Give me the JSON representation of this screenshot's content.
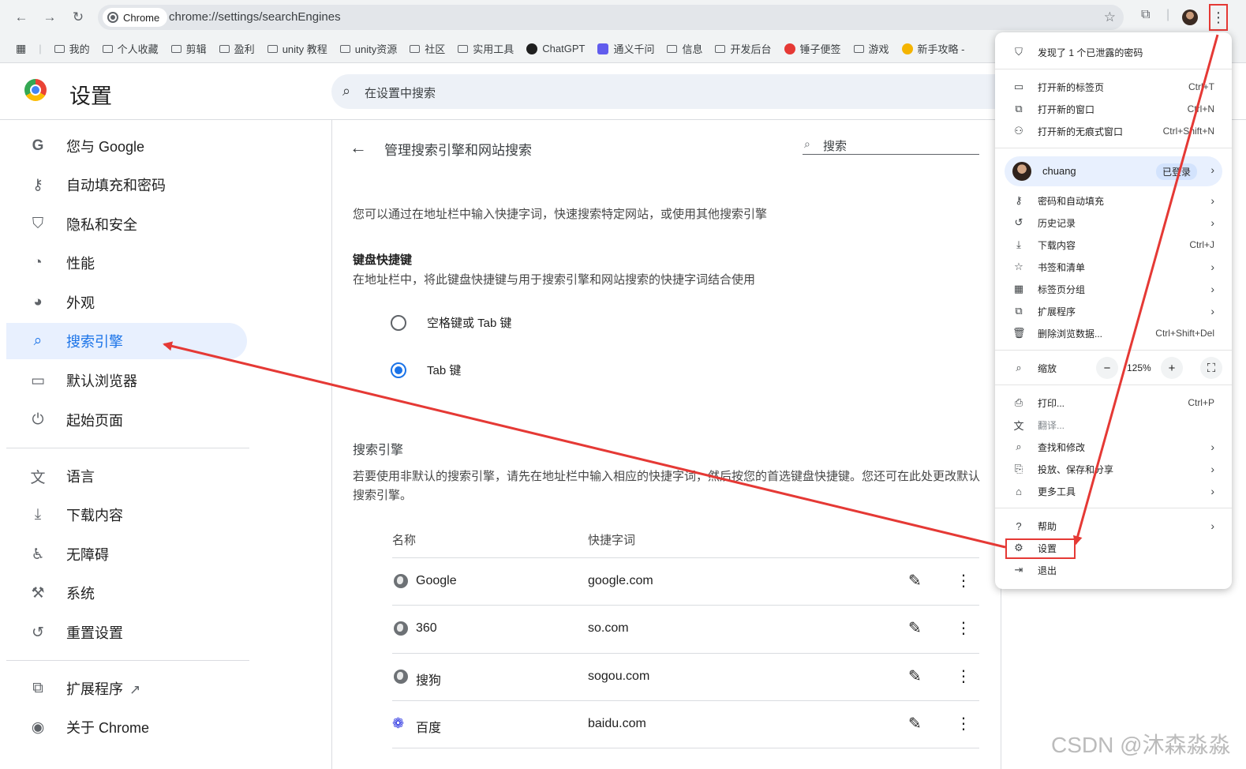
{
  "browser": {
    "chip_label": "Chrome",
    "url": "chrome://settings/searchEngines",
    "bookmarks": [
      "我的",
      "个人收藏",
      "剪辑",
      "盈利",
      "unity 教程",
      "unity资源",
      "社区",
      "实用工具",
      "ChatGPT",
      "通义千问",
      "信息",
      "开发后台",
      "锤子便签",
      "游戏",
      "新手攻略 -"
    ]
  },
  "header": {
    "title": "设置",
    "search_placeholder": "在设置中搜索"
  },
  "sidebar": {
    "items": [
      {
        "label": "您与 Google",
        "icon": "google-g-icon"
      },
      {
        "label": "自动填充和密码",
        "icon": "key-icon"
      },
      {
        "label": "隐私和安全",
        "icon": "shield-icon"
      },
      {
        "label": "性能",
        "icon": "speedometer-icon"
      },
      {
        "label": "外观",
        "icon": "palette-icon"
      },
      {
        "label": "搜索引擎",
        "icon": "search-icon"
      },
      {
        "label": "默认浏览器",
        "icon": "browser-window-icon"
      },
      {
        "label": "起始页面",
        "icon": "power-icon"
      },
      {
        "label": "语言",
        "icon": "translate-icon"
      },
      {
        "label": "下载内容",
        "icon": "download-icon"
      },
      {
        "label": "无障碍",
        "icon": "accessibility-icon"
      },
      {
        "label": "系统",
        "icon": "wrench-icon"
      },
      {
        "label": "重置设置",
        "icon": "reset-icon"
      },
      {
        "label": "扩展程序",
        "icon": "puzzle-icon"
      },
      {
        "label": "关于 Chrome",
        "icon": "chrome-icon"
      }
    ],
    "active_index": 5
  },
  "main": {
    "page_title": "管理搜索引擎和网站搜索",
    "search_placeholder": "搜索",
    "intro": "您可以通过在地址栏中输入快捷字词，快速搜索特定网站，或使用其他搜索引擎",
    "shortcut_heading": "键盘快捷键",
    "shortcut_desc": "在地址栏中，将此键盘快捷键与用于搜索引擎和网站搜索的快捷字词结合使用",
    "radio_options": [
      {
        "label": "空格键或 Tab 键",
        "selected": false
      },
      {
        "label": "Tab 键",
        "selected": true
      }
    ],
    "engines_heading": "搜索引擎",
    "engines_desc": "若要使用非默认的搜索引擎，请先在地址栏中输入相应的快捷字词，然后按您的首选键盘快捷键。您还可在此处更改默认搜索引擎。",
    "columns": [
      "名称",
      "快捷字词"
    ],
    "engines": [
      {
        "name": "Google",
        "keyword": "google.com",
        "icon": "globe-icon"
      },
      {
        "name": "360",
        "keyword": "so.com",
        "icon": "globe-icon"
      },
      {
        "name": "搜狗",
        "keyword": "sogou.com",
        "icon": "globe-icon"
      },
      {
        "name": "百度",
        "keyword": "baidu.com",
        "icon": "baidu-paw-icon"
      }
    ]
  },
  "menu": {
    "alert": "发现了 1 个已泄露的密码",
    "group1": [
      {
        "label": "打开新的标签页",
        "shortcut": "Ctrl+T"
      },
      {
        "label": "打开新的窗口",
        "shortcut": "Ctrl+N"
      },
      {
        "label": "打开新的无痕式窗口",
        "shortcut": "Ctrl+Shift+N"
      }
    ],
    "profile_name": "chuang",
    "profile_badge": "已登录",
    "group2": [
      {
        "label": "密码和自动填充",
        "shortcut": ""
      },
      {
        "label": "历史记录",
        "shortcut": ""
      },
      {
        "label": "下载内容",
        "shortcut": "Ctrl+J"
      },
      {
        "label": "书签和清单",
        "shortcut": ""
      },
      {
        "label": "标签页分组",
        "shortcut": ""
      },
      {
        "label": "扩展程序",
        "shortcut": ""
      },
      {
        "label": "删除浏览数据...",
        "shortcut": "Ctrl+Shift+Del"
      }
    ],
    "zoom_label": "缩放",
    "zoom_value": "125%",
    "group3": [
      {
        "label": "打印...",
        "shortcut": "Ctrl+P"
      },
      {
        "label": "翻译...",
        "shortcut": ""
      },
      {
        "label": "查找和修改",
        "shortcut": ""
      },
      {
        "label": "投放、保存和分享",
        "shortcut": ""
      },
      {
        "label": "更多工具",
        "shortcut": ""
      }
    ],
    "group4": [
      {
        "label": "帮助",
        "shortcut": ""
      },
      {
        "label": "设置",
        "shortcut": ""
      },
      {
        "label": "退出",
        "shortcut": ""
      }
    ]
  },
  "annotation": {
    "color": "#e53935"
  },
  "watermark": "CSDN @沐森淼淼"
}
